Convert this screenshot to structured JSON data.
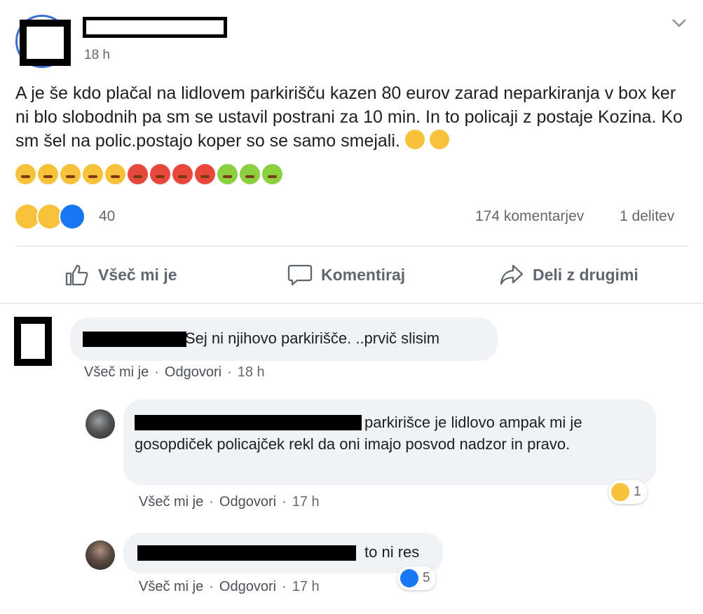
{
  "post": {
    "timestamp": "18 h",
    "text": "A je še kdo plačal na lidlovem parkirišču kazen 80 eurov zarad neparkiranja v box ker ni blo slobodnih pa sm se ustavil postrani za 10 min. In to policaji z postaje Kozina. Ko sm šel na polic.postajo koper so se samo smejali.",
    "reaction_count": "40",
    "comments_count": "174 komentarjev",
    "shares_count": "1 delitev"
  },
  "actions": {
    "like": "Všeč mi je",
    "comment": "Komentiraj",
    "share": "Deli z drugimi"
  },
  "comments": [
    {
      "text": "Sej ni njihovo parkirišče. ..prvič slisim",
      "like_label": "Všeč mi je",
      "reply_label": "Odgovori",
      "time": "18 h"
    },
    {
      "text": "parkirišce je lidlovo ampak mi je gosopdiček policajček rekl da oni imajo posvod nadzor in pravo.",
      "like_label": "Všeč mi je",
      "reply_label": "Odgovori",
      "time": "17 h",
      "reaction_count": "1"
    },
    {
      "text": "to ni res",
      "like_label": "Všeč mi je",
      "reply_label": "Odgovori",
      "time": "17 h",
      "reaction_count": "5"
    }
  ],
  "colors": {
    "brand_blue": "#1877f2",
    "muted": "#65676b",
    "bubble": "#f0f2f5"
  },
  "icons": [
    "chevron-down-icon",
    "like-icon",
    "comment-icon",
    "share-icon",
    "haha-reaction-icon",
    "wow-reaction-icon",
    "like-reaction-icon"
  ]
}
